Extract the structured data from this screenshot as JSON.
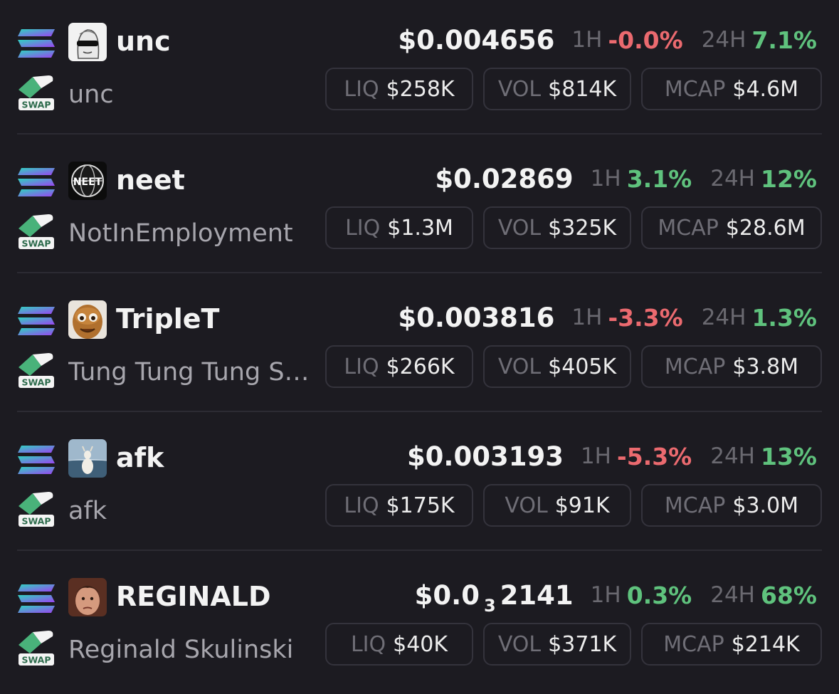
{
  "tokens": [
    {
      "symbol": "unc",
      "name": "unc",
      "price": "$0.004656",
      "price_subscript": "",
      "price_tail": "",
      "h1_label": "1H",
      "h1_change": "-0.0%",
      "h1_direction": "down",
      "h24_label": "24H",
      "h24_change": "7.1%",
      "h24_direction": "up",
      "liq_label": "LIQ",
      "liq": "$258K",
      "vol_label": "VOL",
      "vol": "$814K",
      "mcap_label": "MCAP",
      "mcap": "$4.6M",
      "avatar_icon": "wojak-sunglasses-avatar",
      "swap_label": "SWAP"
    },
    {
      "symbol": "neet",
      "name": "NotInEmployment",
      "price": "$0.02869",
      "price_subscript": "",
      "price_tail": "",
      "h1_label": "1H",
      "h1_change": "3.1%",
      "h1_direction": "up",
      "h24_label": "24H",
      "h24_change": "12%",
      "h24_direction": "up",
      "liq_label": "LIQ",
      "liq": "$1.3M",
      "vol_label": "VOL",
      "vol": "$325K",
      "mcap_label": "MCAP",
      "mcap": "$28.6M",
      "avatar_icon": "neet-globe-avatar",
      "avatar_text": "NEET",
      "swap_label": "SWAP"
    },
    {
      "symbol": "TripleT",
      "name": "Tung Tung Tung Sahur",
      "price": "$0.003816",
      "price_subscript": "",
      "price_tail": "",
      "h1_label": "1H",
      "h1_change": "-3.3%",
      "h1_direction": "down",
      "h24_label": "24H",
      "h24_change": "1.3%",
      "h24_direction": "up",
      "liq_label": "LIQ",
      "liq": "$266K",
      "vol_label": "VOL",
      "vol": "$405K",
      "mcap_label": "MCAP",
      "mcap": "$3.8M",
      "avatar_icon": "wooden-face-avatar",
      "swap_label": "SWAP"
    },
    {
      "symbol": "afk",
      "name": "afk",
      "price": "$0.003193",
      "price_subscript": "",
      "price_tail": "",
      "h1_label": "1H",
      "h1_change": "-5.3%",
      "h1_direction": "down",
      "h24_label": "24H",
      "h24_change": "13%",
      "h24_direction": "up",
      "liq_label": "LIQ",
      "liq": "$175K",
      "vol_label": "VOL",
      "vol": "$91K",
      "mcap_label": "MCAP",
      "mcap": "$3.0M",
      "avatar_icon": "goat-at-sea-avatar",
      "swap_label": "SWAP"
    },
    {
      "symbol": "REGINALD",
      "name": "Reginald Skulinski",
      "price": "$0.0",
      "price_subscript": "3",
      "price_tail": "2141",
      "h1_label": "1H",
      "h1_change": "0.3%",
      "h1_direction": "up",
      "h24_label": "24H",
      "h24_change": "68%",
      "h24_direction": "up",
      "liq_label": "LIQ",
      "liq": "$40K",
      "vol_label": "VOL",
      "vol": "$371K",
      "mcap_label": "MCAP",
      "mcap": "$214K",
      "avatar_icon": "reginald-face-avatar",
      "swap_label": "SWAP"
    }
  ],
  "colors": {
    "background": "#1c1b21",
    "positive": "#5fc27d",
    "negative": "#eb6a6f",
    "pill_border": "#34333c",
    "muted": "#6a6970"
  },
  "icons": {
    "chain": "solana-icon",
    "dex": "swap-icon"
  }
}
